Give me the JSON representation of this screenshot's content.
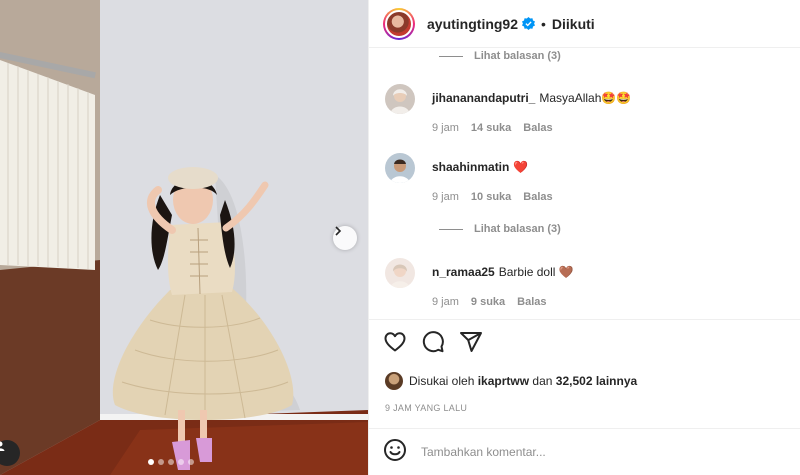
{
  "post": {
    "username": "ayutingting92",
    "separator": "•",
    "follow_state": "Diikuti",
    "carousel_count": 5,
    "carousel_active": 0
  },
  "comments": {
    "view_replies_top": "Lihat balasan (3)",
    "items": [
      {
        "user": "jihananandaputri_",
        "text": "MasyaAllah🤩🤩",
        "time": "9 jam",
        "likes": "14 suka",
        "reply": "Balas"
      },
      {
        "user": "shaahinmatin",
        "text": "❤️",
        "time": "9 jam",
        "likes": "10 suka",
        "reply": "Balas"
      },
      {
        "user": "n_ramaa25",
        "text": "Barbie doll 🤎",
        "time": "9 jam",
        "likes": "9 suka",
        "reply": "Balas"
      }
    ],
    "view_replies_mid": "Lihat balasan (3)"
  },
  "likes": {
    "prefix": "Disukai oleh",
    "user": "ikaprtww",
    "middle": "dan",
    "count": "32,502",
    "suffix": "lainnya"
  },
  "time_ago": "9 JAM YANG LALU",
  "add_comment": {
    "placeholder": "Tambahkan komentar..."
  },
  "icons": [
    "heart-icon",
    "comment-icon",
    "share-icon",
    "emoji-icon",
    "chevron-right-icon",
    "verified-badge-icon"
  ],
  "colors": {
    "verified": "#0095f6",
    "text_secondary": "#8e8e8e",
    "border": "#efefef"
  }
}
